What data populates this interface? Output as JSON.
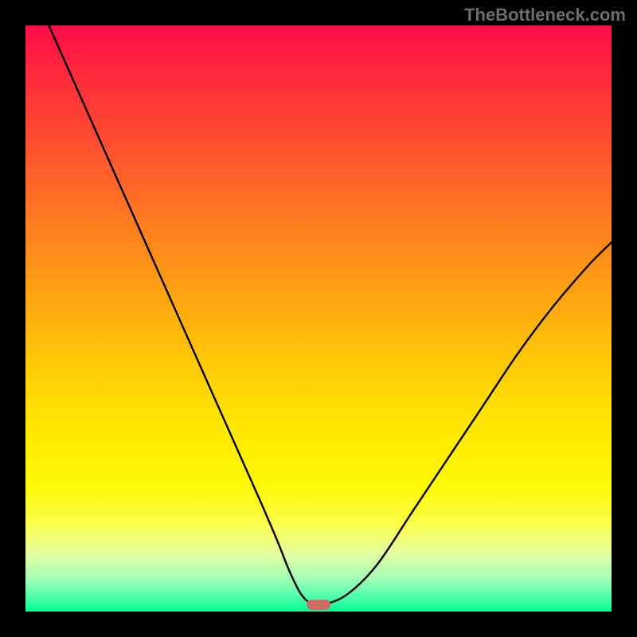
{
  "watermark": "TheBottleneck.com",
  "colors": {
    "background": "#000000",
    "gradient_top": "#ff0b4a",
    "gradient_mid": "#ffe602",
    "gradient_bottom": "#03ff94",
    "curve_stroke": "#000000",
    "marker": "#cf6b66"
  },
  "chart_data": {
    "type": "line",
    "title": "",
    "xlabel": "",
    "ylabel": "",
    "xlim": [
      0,
      100
    ],
    "ylim": [
      0,
      100
    ],
    "grid": false,
    "series": [
      {
        "name": "bottleneck-curve",
        "x": [
          4,
          8,
          12,
          16,
          20,
          24,
          28,
          32,
          36,
          40,
          43,
          45,
          47,
          49,
          51,
          55,
          60,
          66,
          72,
          78,
          84,
          90,
          96,
          100
        ],
        "y": [
          100,
          91,
          82,
          73,
          64,
          55,
          46,
          37,
          28,
          19,
          12,
          7,
          3,
          1.2,
          1.2,
          3,
          8,
          17,
          26,
          35,
          44,
          52,
          59,
          63
        ]
      }
    ],
    "marker": {
      "x": 50,
      "y": 1.2,
      "width_pct": 4.0,
      "height_pct": 1.8
    }
  }
}
